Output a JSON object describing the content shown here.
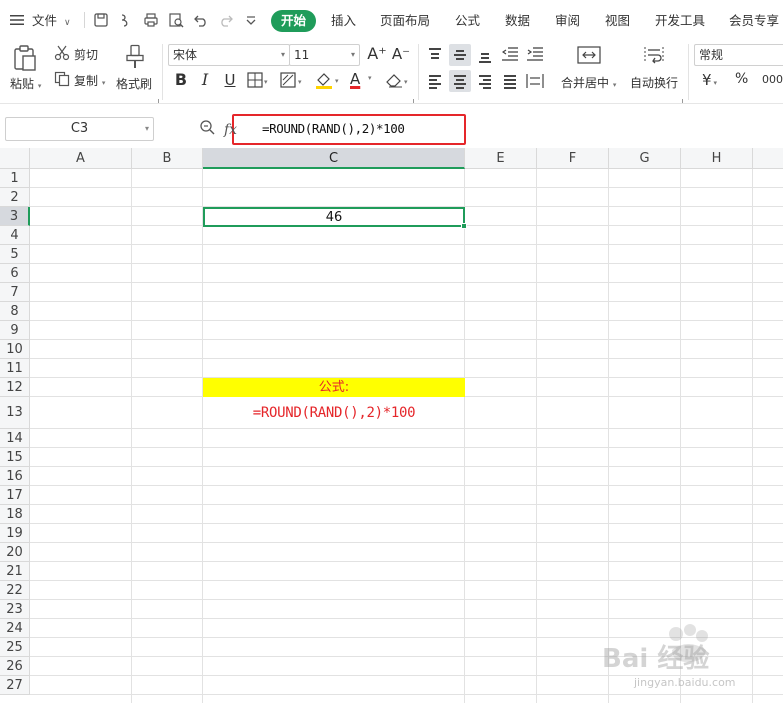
{
  "menubar": {
    "file_label": "文件",
    "tabs": [
      "开始",
      "插入",
      "页面布局",
      "公式",
      "数据",
      "审阅",
      "视图",
      "开发工具",
      "会员专享"
    ],
    "active_tab": "开始"
  },
  "ribbon": {
    "paste_label": "粘贴",
    "cut_label": "剪切",
    "copy_label": "复制",
    "format_painter_label": "格式刷",
    "font_name": "宋体",
    "font_size": "11",
    "increase_font_glyph": "A⁺",
    "decrease_font_glyph": "A⁻",
    "bold": "B",
    "italic": "I",
    "underline": "U",
    "font_color_glyph": "A",
    "merge_center_label": "合并居中",
    "wrap_text_label": "自动换行",
    "number_format": "常规",
    "currency_glyph": "¥",
    "percent_glyph": "%",
    "comma_glyph": "000",
    "accent_color": "#1f9c5a",
    "highlight_color": "#ffd400",
    "font_color": "#e5262a"
  },
  "formula_bar": {
    "name_box": "C3",
    "fx_label": "fx",
    "formula": "=ROUND(RAND(),2)*100"
  },
  "grid": {
    "columns": [
      "A",
      "B",
      "C",
      "E",
      "F",
      "G",
      "H"
    ],
    "selected_column": "C",
    "rows": [
      "1",
      "2",
      "3",
      "4",
      "5",
      "6",
      "7",
      "8",
      "9",
      "10",
      "11",
      "12",
      "13",
      "14",
      "15",
      "16",
      "17",
      "18",
      "19",
      "20",
      "21",
      "22",
      "23",
      "24",
      "25",
      "26",
      "27"
    ],
    "selected_row": "3",
    "cells": {
      "C3": "46",
      "C12": "公式:",
      "C13": "=ROUND(RAND(),2)*100"
    }
  },
  "watermark": {
    "brand": "Bai 经验",
    "url": "jingyan.baidu.com"
  }
}
